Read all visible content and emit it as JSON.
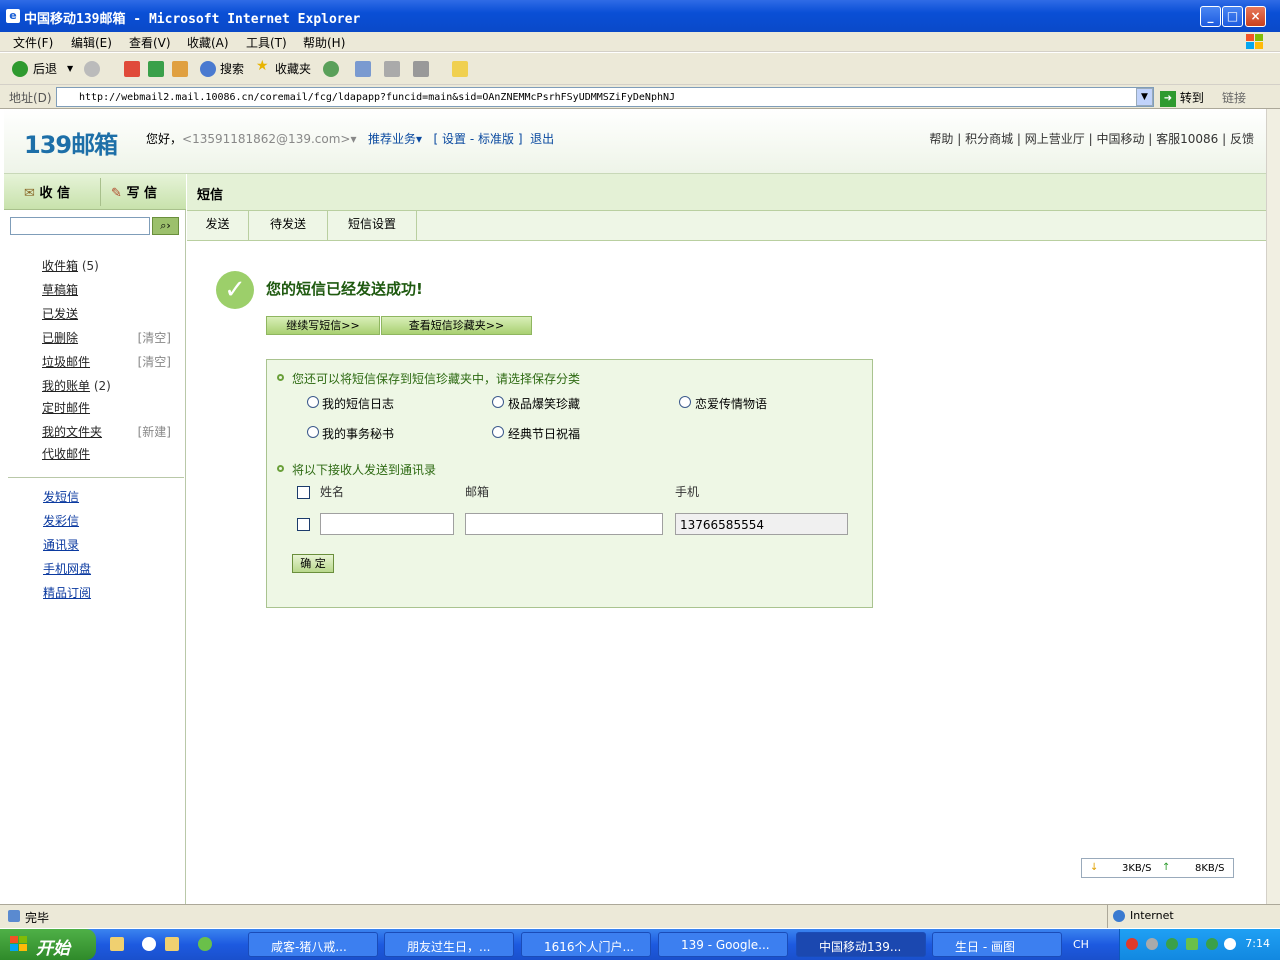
{
  "window": {
    "title": "中国移动139邮箱 - Microsoft Internet Explorer"
  },
  "menu": [
    "文件(F)",
    "编辑(E)",
    "查看(V)",
    "收藏(A)",
    "工具(T)",
    "帮助(H)"
  ],
  "toolbar": {
    "back": "后退",
    "search": "搜索",
    "favorites": "收藏夹"
  },
  "address": {
    "label": "地址(D)",
    "url": "http://webmail2.mail.10086.cn/coremail/fcg/ldapapp?funcid=main&sid=OAnZNEMMcPsrhFSyUDMMSZiFyDeNphNJ",
    "go": "转到",
    "links": "链接"
  },
  "header": {
    "logo": "139邮箱",
    "greeting": "您好，",
    "account": "<13591181862@139.com>",
    "recommend": "推荐业务",
    "bracket_open": "[",
    "settings": "设置",
    "dash": "-",
    "standard": "标准版",
    "bracket_close": "]",
    "logout": "退出",
    "links": [
      "帮助",
      "积分商城",
      "网上营业厅",
      "中国移动",
      "客服10086",
      "反馈"
    ]
  },
  "left": {
    "receive": "收 信",
    "write": "写 信",
    "folders": [
      {
        "name": "收件箱",
        "count": "(5)",
        "extra": ""
      },
      {
        "name": "草稿箱",
        "count": "",
        "extra": ""
      },
      {
        "name": "已发送",
        "count": "",
        "extra": ""
      },
      {
        "name": "已删除",
        "count": "",
        "extra": "[清空]"
      },
      {
        "name": "垃圾邮件",
        "count": "",
        "extra": "[清空]"
      },
      {
        "name": "我的账单",
        "count": "(2)",
        "extra": ""
      },
      {
        "name": "定时邮件",
        "count": "",
        "extra": ""
      },
      {
        "name": "我的文件夹",
        "count": "",
        "extra": "[新建]"
      },
      {
        "name": "代收邮件",
        "count": "",
        "extra": ""
      }
    ],
    "links": [
      "发短信",
      "发彩信",
      "通讯录",
      "手机网盘",
      "精品订阅"
    ]
  },
  "main": {
    "title": "短信",
    "tabs": [
      "发送",
      "待发送",
      "短信设置"
    ],
    "success": "您的短信已经发送成功!",
    "btn_continue": "继续写短信>>",
    "btn_view": "查看短信珍藏夹>>",
    "save_prompt": "您还可以将短信保存到短信珍藏夹中，请选择保存分类",
    "categories": [
      "我的短信日志",
      "极品爆笑珍藏",
      "恋爱传情物语",
      "我的事务秘书",
      "经典节日祝福"
    ],
    "contact_prompt": "将以下接收人发送到通讯录",
    "col_name": "姓名",
    "col_email": "邮箱",
    "col_phone": "手机",
    "phone_value": "13766585554",
    "confirm": "确 定"
  },
  "speed": {
    "down": "3KB/S",
    "up": "8KB/S"
  },
  "status": {
    "text": "完毕",
    "zone": "Internet"
  },
  "taskbar": {
    "start": "开始",
    "tasks": [
      "咸客-猪八戒...",
      "朋友过生日，...",
      "1616个人门户...",
      "139 - Google...",
      "中国移动139...",
      "生日 - 画图"
    ],
    "lang": "CH",
    "time": "7:14"
  }
}
